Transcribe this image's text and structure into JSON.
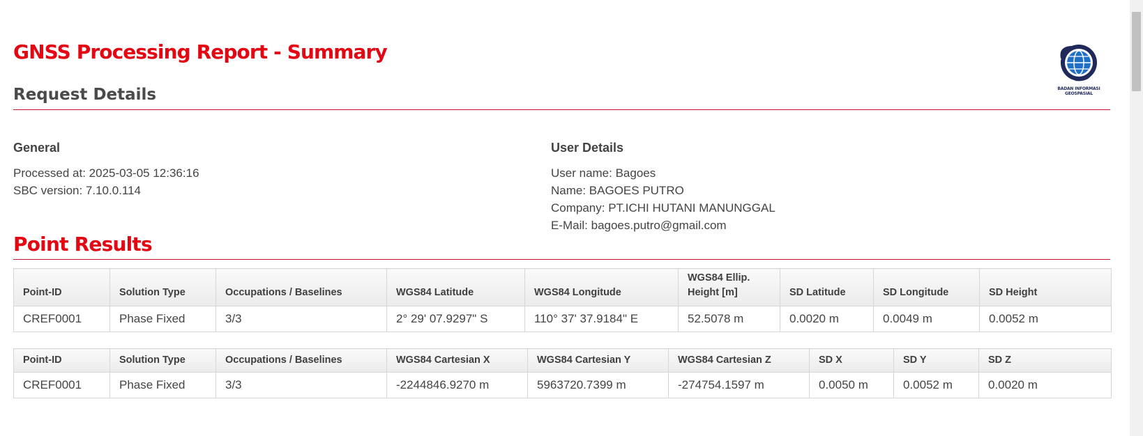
{
  "report": {
    "title": "GNSS Processing Report - Summary"
  },
  "logo": {
    "icon": "globe-icon",
    "line1": "BADAN INFORMASI",
    "line2": "GEOSPASIAL"
  },
  "request_details": {
    "title": "Request Details",
    "general": {
      "title": "General",
      "processed_at": "Processed at: 2025-03-05 12:36:16",
      "sbc_version": "SBC version: 7.10.0.114"
    },
    "user": {
      "title": "User Details",
      "username": "User name: Bagoes",
      "name": "Name: BAGOES PUTRO",
      "company": "Company: PT.ICHI HUTANI MANUNGGAL",
      "email": "E-Mail: bagoes.putro@gmail.com"
    }
  },
  "point_results": {
    "title": "Point Results",
    "geodetic": {
      "headers": [
        "Point-ID",
        "Solution Type",
        "Occupations / Baselines",
        "WGS84 Latitude",
        "WGS84 Longitude",
        "WGS84 Ellip. Height [m]",
        "SD Latitude",
        "SD Longitude",
        "SD Height"
      ],
      "rows": [
        [
          "CREF0001",
          "Phase Fixed",
          "3/3",
          "2° 29' 07.9297\" S",
          "110° 37' 37.9184\" E",
          "52.5078 m",
          "0.0020 m",
          "0.0049 m",
          "0.0052 m"
        ]
      ]
    },
    "cartesian": {
      "headers": [
        "Point-ID",
        "Solution Type",
        "Occupations / Baselines",
        "WGS84 Cartesian X",
        "WGS84 Cartesian Y",
        "WGS84 Cartesian Z",
        "SD X",
        "SD Y",
        "SD Z"
      ],
      "rows": [
        [
          "CREF0001",
          "Phase Fixed",
          "3/3",
          "-2244846.9270 m",
          "5963720.7399 m",
          "-274754.1597 m",
          "0.0050 m",
          "0.0052 m",
          "0.0020 m"
        ]
      ]
    }
  },
  "colors": {
    "accent": "#e30613",
    "rule": "#c8102e",
    "logo_globe": "#1f2a5a"
  }
}
